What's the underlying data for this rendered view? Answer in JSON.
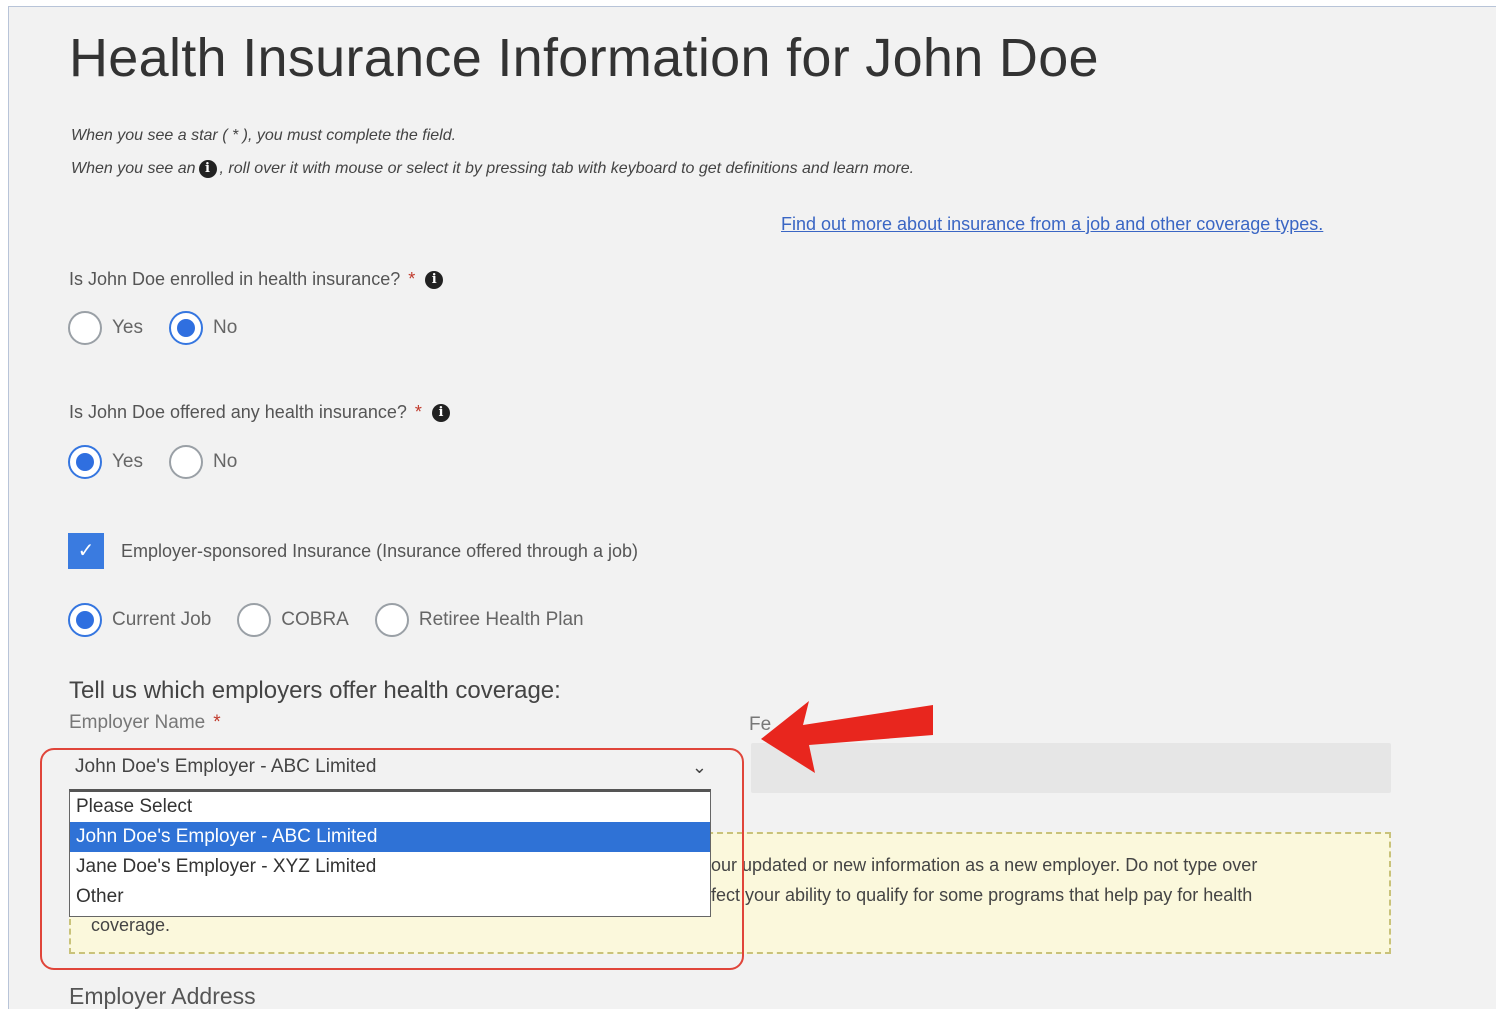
{
  "page": {
    "title": "Health Insurance Information for John Doe",
    "note_required": "When you see a star ( * ), you must complete the field.",
    "note_info_before": "When you see an",
    "note_info_after": ", roll over it with mouse or select it by pressing tab with keyboard to get definitions and learn more.",
    "help_link": "Find out more about insurance from a job and other coverage types."
  },
  "question_enrolled": {
    "label": "Is John Doe enrolled in health insurance?",
    "required": "*",
    "options": [
      "Yes",
      "No"
    ],
    "selected": "No"
  },
  "question_offered": {
    "label": "Is John Doe offered any health insurance?",
    "required": "*",
    "options": [
      "Yes",
      "No"
    ],
    "selected": "Yes"
  },
  "employer_sponsored": {
    "label": "Employer-sponsored Insurance (Insurance offered through a job)",
    "checked": true
  },
  "plan_type": {
    "options": [
      "Current Job",
      "COBRA",
      "Retiree Health Plan"
    ],
    "selected": "Current Job"
  },
  "employers": {
    "heading": "Tell us which employers offer health coverage:",
    "name_label": "Employer Name",
    "required": "*",
    "fein_label": "Fe",
    "selected_value": "John Doe's Employer - ABC Limited",
    "dropdown_options": [
      "Please Select",
      "John Doe's Employer - ABC Limited",
      "Jane Doe's Employer - XYZ Limited",
      "Other"
    ],
    "highlighted_option": "John Doe's Employer - ABC Limited"
  },
  "warning": {
    "line1": "our updated or new information as a new employer. Do not type over",
    "line2": "fect your ability to qualify for some programs that help pay for health",
    "line3": "coverage."
  },
  "address": {
    "label": "Employer Address"
  },
  "icons": {
    "info": "info-icon",
    "check": "check-icon",
    "chevron": "chevron-down-icon",
    "arrow": "red-arrow-icon"
  },
  "colors": {
    "accent": "#2f6fe0",
    "link": "#3a66c4",
    "highlight": "#e0453a",
    "arrow": "#e8261e",
    "warning_bg": "#fbf8dc"
  }
}
